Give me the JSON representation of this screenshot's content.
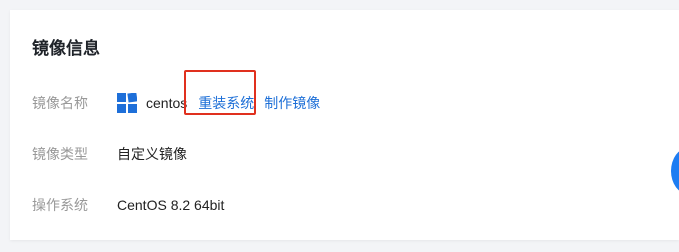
{
  "section": {
    "title": "镜像信息"
  },
  "rows": {
    "image_name": {
      "label": "镜像名称",
      "name": "centos",
      "reinstall_link": "重装系统",
      "create_image_link": "制作镜像"
    },
    "image_type": {
      "label": "镜像类型",
      "value": "自定义镜像"
    },
    "os": {
      "label": "操作系统",
      "value": "CentOS 8.2 64bit"
    }
  },
  "icons": {
    "image_icon": "windows-logo-icon",
    "float_button": "help-float-button"
  },
  "colors": {
    "link": "#1d6fd7",
    "highlight": "#e0301e",
    "icon": "#1e6fd9",
    "float": "#1e7df2"
  }
}
